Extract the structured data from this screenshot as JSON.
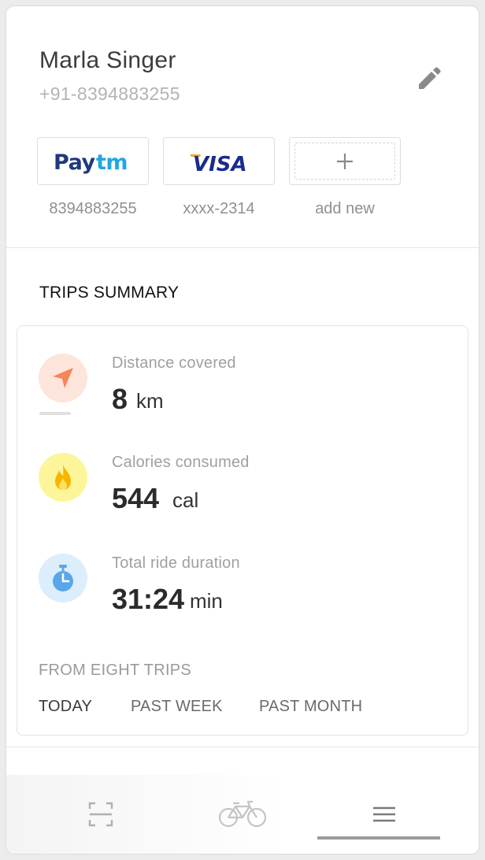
{
  "profile": {
    "name": "Marla Singer",
    "phone": "+91-8394883255"
  },
  "payment_methods": [
    {
      "logo": "Paytm",
      "label": "8394883255"
    },
    {
      "logo": "VISA",
      "label": "xxxx-2314"
    },
    {
      "logo": "+",
      "label": "add new"
    }
  ],
  "trips_summary": {
    "title": "TRIPS SUMMARY",
    "stats": [
      {
        "label": "Distance covered",
        "value": "8",
        "unit": "km",
        "icon": "navigation-arrow-icon",
        "color": "#f5865a",
        "bg": "#fde5dc"
      },
      {
        "label": "Calories consumed",
        "value": "544",
        "unit": "cal",
        "icon": "flame-icon",
        "color": "#f7b500",
        "bg": "#fdf59a"
      },
      {
        "label": "Total ride duration",
        "value": "31:24",
        "unit": "min",
        "icon": "stopwatch-icon",
        "color": "#5ba6e8",
        "bg": "#dceefc"
      }
    ],
    "footer": "FROM EIGHT TRIPS",
    "periods": [
      "TODAY",
      "PAST WEEK",
      "PAST MONTH"
    ],
    "active_period": "TODAY"
  },
  "bottom_nav": {
    "items": [
      {
        "icon": "scan-icon"
      },
      {
        "icon": "bicycle-icon"
      },
      {
        "icon": "menu-icon"
      }
    ],
    "active_index": 2
  }
}
